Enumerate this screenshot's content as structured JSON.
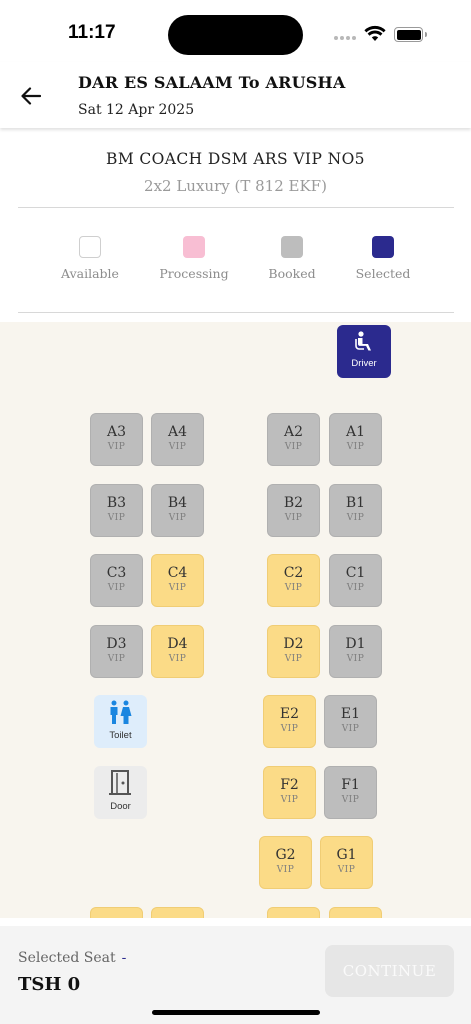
{
  "status": {
    "time": "11:17"
  },
  "header": {
    "title": "DAR ES SALAAM To ARUSHA",
    "date": "Sat 12 Apr 2025"
  },
  "bus": {
    "name": "BM COACH DSM ARS VIP NO5",
    "type": "2x2 Luxury (T 812 EKF)"
  },
  "legend": [
    {
      "label": "Available",
      "color": "#ffffff"
    },
    {
      "label": "Processing",
      "color": "#f8bed3"
    },
    {
      "label": "Booked",
      "color": "#bdbdbd"
    },
    {
      "label": "Selected",
      "color": "#2b2a8e"
    }
  ],
  "driver": {
    "label": "Driver"
  },
  "seat_class": "VIP",
  "seats": [
    {
      "id": "A3",
      "status": "booked"
    },
    {
      "id": "A4",
      "status": "booked"
    },
    {
      "id": "A2",
      "status": "booked"
    },
    {
      "id": "A1",
      "status": "booked"
    },
    {
      "id": "B3",
      "status": "booked"
    },
    {
      "id": "B4",
      "status": "booked"
    },
    {
      "id": "B2",
      "status": "booked"
    },
    {
      "id": "B1",
      "status": "booked"
    },
    {
      "id": "C3",
      "status": "booked"
    },
    {
      "id": "C4",
      "status": "processing"
    },
    {
      "id": "C2",
      "status": "processing"
    },
    {
      "id": "C1",
      "status": "booked"
    },
    {
      "id": "D3",
      "status": "booked"
    },
    {
      "id": "D4",
      "status": "processing"
    },
    {
      "id": "D2",
      "status": "processing"
    },
    {
      "id": "D1",
      "status": "booked"
    },
    {
      "id": "E2",
      "status": "processing"
    },
    {
      "id": "E1",
      "status": "booked"
    },
    {
      "id": "F2",
      "status": "processing"
    },
    {
      "id": "F1",
      "status": "booked"
    },
    {
      "id": "G2",
      "status": "processing"
    },
    {
      "id": "G1",
      "status": "processing"
    }
  ],
  "facilities": {
    "toilet": "Toilet",
    "door": "Door"
  },
  "footer": {
    "selected_label": "Selected Seat",
    "selected_value": "-",
    "price": "TSH 0",
    "continue_label": "CONTINUE"
  },
  "colors": {
    "accent": "#2b2a8e",
    "processing_seat": "#fbdb87",
    "booked_seat": "#bdbdbd",
    "toilet_icon": "#1a86e0"
  }
}
